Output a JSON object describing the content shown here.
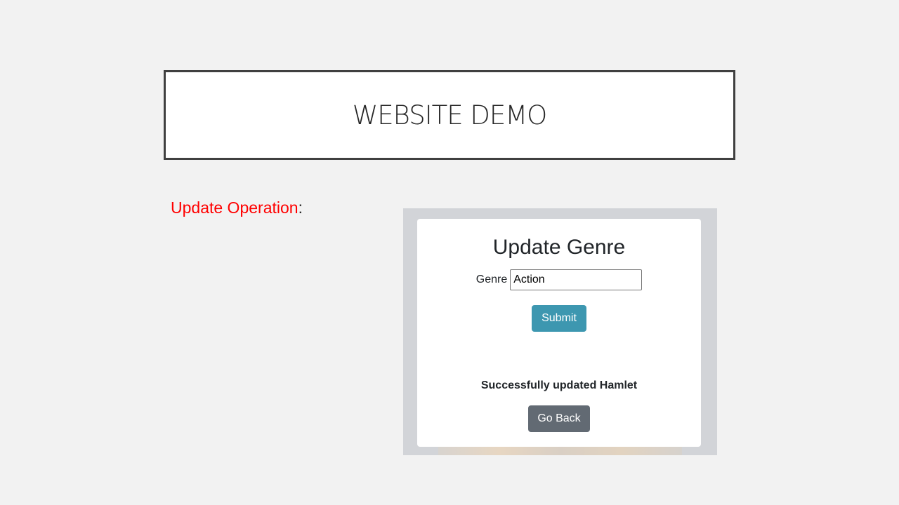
{
  "slide": {
    "title": "WEBSITE DEMO",
    "label_red": "Update Operation",
    "label_suffix": ":"
  },
  "app": {
    "heading": "Update Genre",
    "genre_label": "Genre",
    "genre_value": "Action",
    "submit_label": "Submit",
    "message": "Successfully updated Hamlet",
    "back_label": "Go Back"
  }
}
